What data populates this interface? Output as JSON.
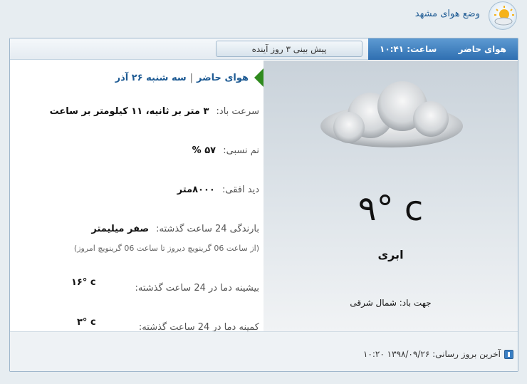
{
  "header": {
    "title": "وضع هوای مشهد",
    "logo_icon": "sun-cloud-icon"
  },
  "tabs": {
    "current_label": "هوای حاضر",
    "clock": "ساعت: ۱۰:۴۱",
    "forecast_label": "پیش بینی ۳ روز آینده"
  },
  "current": {
    "temperature": "۹° c",
    "condition": "ابری",
    "wind_direction": "جهت باد: شمال شرقی",
    "icon": "cloud-icon"
  },
  "details": {
    "heading_label": "هوای حاضر",
    "heading_date": "سه شنبه ۲۶ آذر",
    "wind_speed_label": "سرعت باد:",
    "wind_speed_value": "۳ متر بر ثانیه، ۱۱ کیلومتر بر ساعت",
    "humidity_label": "نم نسبی:",
    "humidity_value": "۵۷ %",
    "visibility_label": "دید افقی:",
    "visibility_value": "۸۰۰۰متر",
    "rain_label": "بارندگی 24 ساعت گذشته:",
    "rain_value": "صفر میلیمتر",
    "rain_note": "(از ساعت 06 گرینویچ دیروز تا ساعت 06 گرینویچ امروز)",
    "max_label": "بیشینه دما در 24 ساعت گذشته:",
    "max_value": "۱۶° c",
    "min_label": "کمینه دما در 24 ساعت گذشته:",
    "min_value": "۳° c"
  },
  "footer": {
    "last_update": "آخرین بروز رسانی: ۱۳۹۸/۰۹/۲۶ ۱۰:۲۰",
    "icon": "info-icon"
  },
  "colors": {
    "accent": "#2f6fb1",
    "title": "#1d5a93",
    "marker": "#2f8a1e"
  }
}
